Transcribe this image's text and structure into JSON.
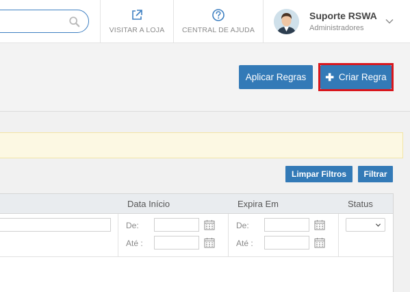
{
  "header": {
    "search": {
      "placeholder": "",
      "value": ""
    },
    "links": [
      {
        "label": "VISITAR A LOJA",
        "icon": "external-link-icon"
      },
      {
        "label": "CENTRAL DE AJUDA",
        "icon": "help-circle-icon"
      }
    ],
    "user": {
      "name": "Suporte RSWA",
      "role": "Administradores"
    }
  },
  "toolbar": {
    "apply_label": "Aplicar Regras",
    "create_label": "Criar Regra",
    "create_icon": "plus-icon"
  },
  "filters": {
    "clear_label": "Limpar Filtros",
    "filter_label": "Filtrar"
  },
  "table": {
    "columns": [
      "Data Início",
      "Expira Em",
      "Status"
    ],
    "date_start": {
      "from_label": "De:",
      "to_label": "Até :"
    },
    "expires": {
      "from_label": "De:",
      "to_label": "Até :"
    },
    "status_value": ""
  },
  "colors": {
    "primary": "#337ab7",
    "highlight_border": "#d9161c",
    "alert_bg": "#fcf8e3"
  }
}
